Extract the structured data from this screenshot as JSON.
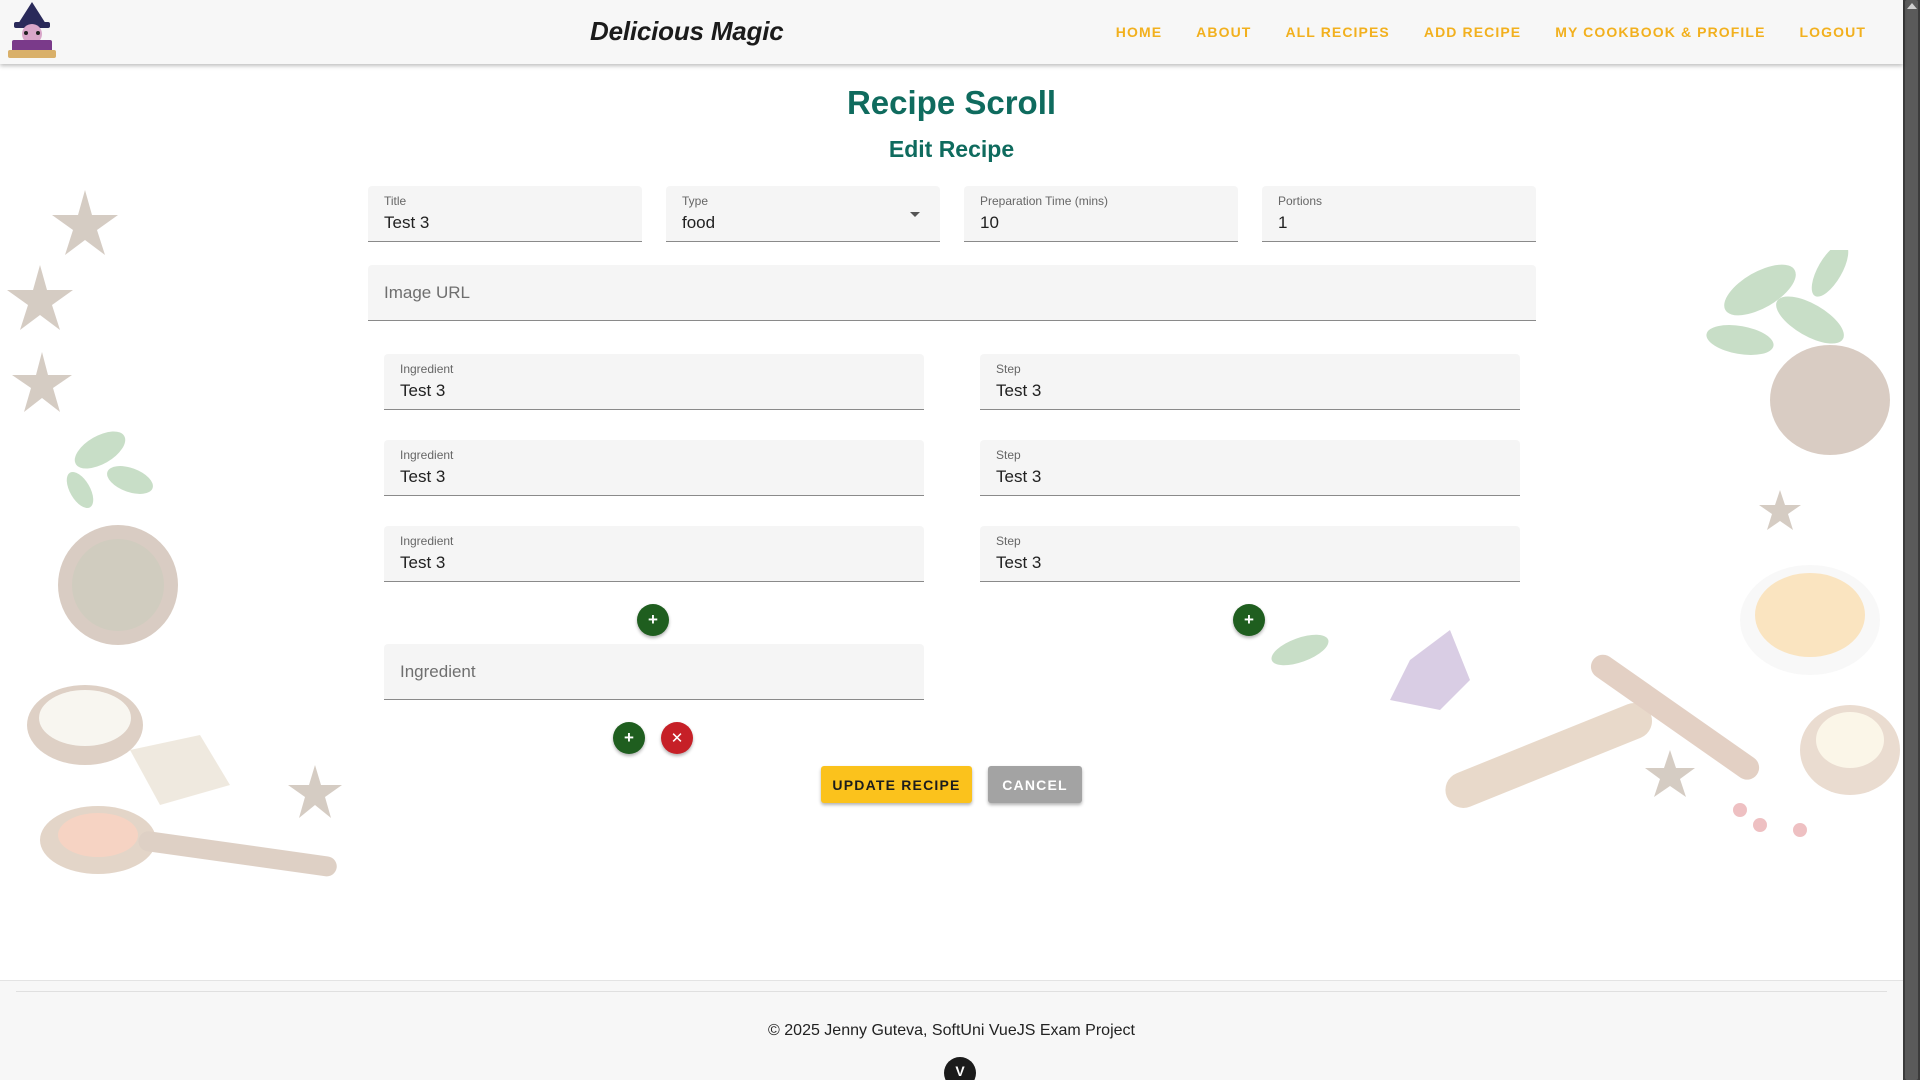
{
  "header": {
    "brand": "Delicious Magic",
    "nav": [
      {
        "label": "HOME"
      },
      {
        "label": "ABOUT"
      },
      {
        "label": "ALL RECIPES"
      },
      {
        "label": "ADD RECIPE"
      },
      {
        "label": "MY COOKBOOK & PROFILE"
      },
      {
        "label": "LOGOUT"
      }
    ]
  },
  "main": {
    "title": "Recipe Scroll",
    "subtitle": "Edit Recipe",
    "fields": {
      "title": {
        "label": "Title",
        "value": "Test 3"
      },
      "type": {
        "label": "Type",
        "value": "food"
      },
      "prep_time": {
        "label": "Preparation Time (mins)",
        "value": "10"
      },
      "portions": {
        "label": "Portions",
        "value": "1"
      },
      "image_url": {
        "placeholder": "Image URL",
        "value": ""
      }
    },
    "ingredients": [
      {
        "label": "Ingredient",
        "value": "Test 3"
      },
      {
        "label": "Ingredient",
        "value": "Test 3"
      },
      {
        "label": "Ingredient",
        "value": "Test 3"
      }
    ],
    "steps": [
      {
        "label": "Step",
        "value": "Test 3"
      },
      {
        "label": "Step",
        "value": "Test 3"
      },
      {
        "label": "Step",
        "value": "Test 3"
      }
    ],
    "new_ingredient": {
      "placeholder": "Ingredient"
    },
    "add_symbol": "+",
    "remove_symbol": "✕",
    "update_label": "Update Recipe",
    "cancel_label": "Cancel"
  },
  "footer": {
    "copyright": "© 2025 Jenny Guteva, SoftUni VueJS Exam Project",
    "badge": "V"
  },
  "colors": {
    "heading": "#0f6b5e",
    "nav": "#f2b01e",
    "add_button": "#1f5e1f",
    "remove_button": "#c62027",
    "update_button": "#fbc21c",
    "cancel_button": "#a3a3a3"
  }
}
